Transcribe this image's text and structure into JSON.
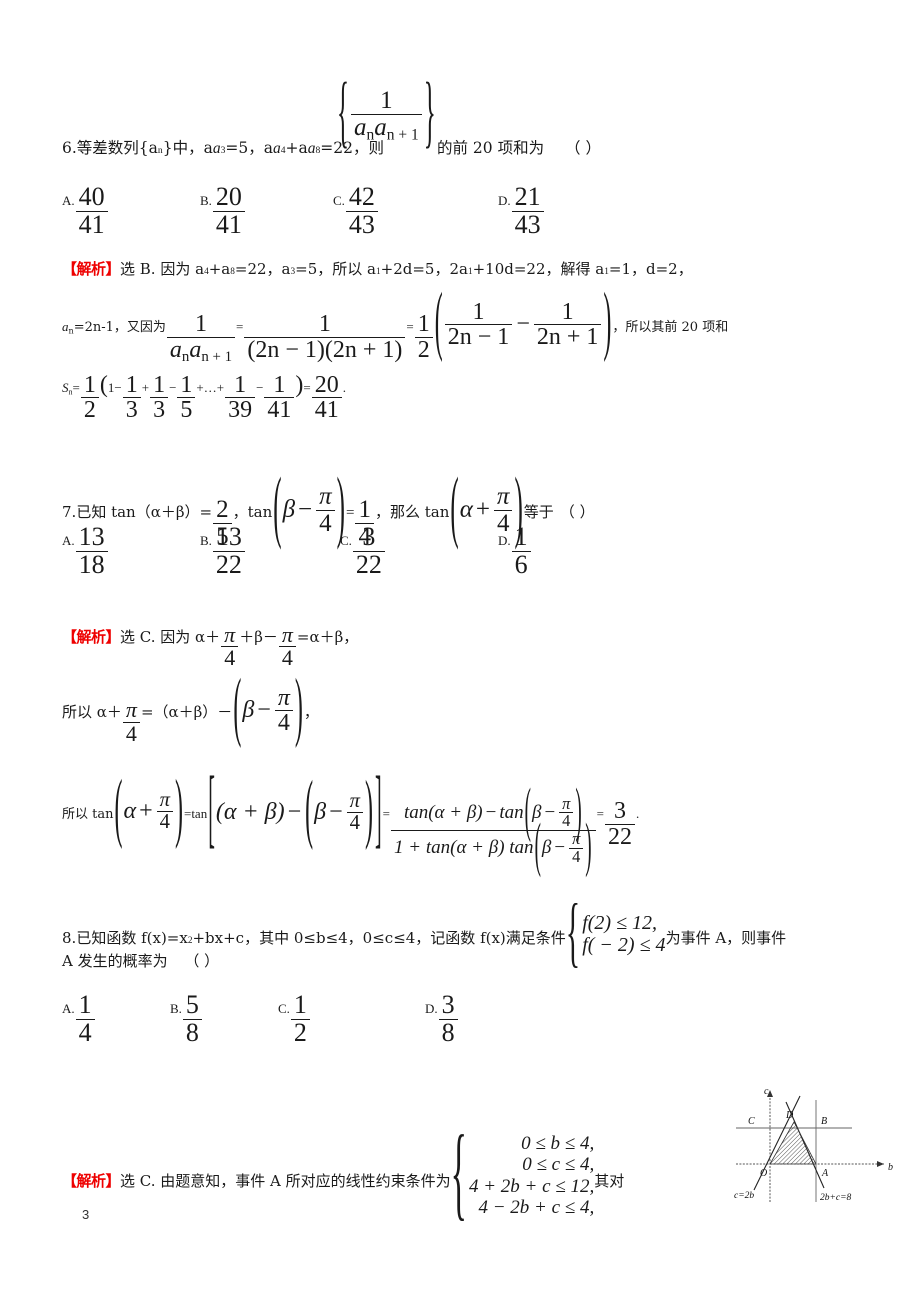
{
  "page": {
    "number": "3",
    "subject_note": ""
  },
  "questions": [
    {
      "id": "q6",
      "number": "6.",
      "stem_before": "等差数列{a",
      "stem_sub1": "n",
      "stem_mid1": "}中，a",
      "stem_sub2": "3",
      "stem_mid2": "=5，a",
      "stem_sub3": "4",
      "stem_mid3": "+a",
      "stem_sub4": "8",
      "stem_mid4": "=22，则",
      "seq_num": "1",
      "seq_den_a": "a",
      "seq_den_sub1": "n",
      "seq_den_b": "a",
      "seq_den_sub2": "n + 1",
      "stem_after": "的前 20 项和为",
      "blank": "（    ）",
      "options": [
        {
          "label": "A.",
          "num": "40",
          "den": "41"
        },
        {
          "label": "B.",
          "num": "20",
          "den": "41"
        },
        {
          "label": "C.",
          "num": "42",
          "den": "43"
        },
        {
          "label": "D.",
          "num": "21",
          "den": "43"
        }
      ],
      "explanation": {
        "tag": "【解析】",
        "line1": "选 B. 因为 a",
        "line1_sub1": "4",
        "line1_b": "+a",
        "line1_sub2": "8",
        "line1_c": "=22，a",
        "line1_sub3": "3",
        "line1_d": "=5，所以 a",
        "line1_sub4": "1",
        "line1_e": "+2d=5，2a",
        "line1_sub5": "1",
        "line1_f": "+10d=22，解得 a",
        "line1_sub6": "1",
        "line1_g": "=1，d=2，",
        "line2_prefix": "a",
        "line2_prefix_sub": "n",
        "line2_prefix_b": "=2n-1，又因为",
        "f1_num": "1",
        "f1_den_a": "a",
        "f1_den_sub1": "n",
        "f1_den_b": "a",
        "f1_den_sub2": "n + 1",
        "eq1": "=",
        "f2_num": "1",
        "f2_den": "(2n − 1)(2n + 1)",
        "eq2": "=",
        "half_num": "1",
        "half_den": "2",
        "inner_left_num": "1",
        "inner_left_den": "2n − 1",
        "inner_minus": "−",
        "inner_right_num": "1",
        "inner_right_den": "2n + 1",
        "line2_suffix": "，所以其前 20 项和",
        "sum_label": "S",
        "sum_label_sub": "n",
        "sum_eq": "=",
        "sum_half_num": "1",
        "sum_half_den": "2",
        "sum_open": "(",
        "sum_t1": "1",
        "sum_f1_num": "1",
        "sum_f1_den": "3",
        "sum_f2_num": "1",
        "sum_f2_den": "3",
        "sum_f3_num": "1",
        "sum_f3_den": "5",
        "sum_dots": "+…+",
        "sum_f4_num": "1",
        "sum_f4_den": "39",
        "sum_f5_num": "1",
        "sum_f5_den": "41",
        "sum_close": ")",
        "sum_res_eq": "=",
        "sum_res_num": "20",
        "sum_res_den": "41",
        "sum_period": "."
      }
    },
    {
      "id": "q7",
      "number": "7.",
      "stem_a": "已知 tan（α＋β）=",
      "v1_num": "2",
      "v1_den": "5",
      "stem_b": "，tan",
      "arg1_beta": "β",
      "arg1_minus": "−",
      "arg1_num": "π",
      "arg1_den": "4",
      "stem_c": "=",
      "v2_num": "1",
      "v2_den": "4",
      "stem_d": "，那么 tan",
      "arg2_alpha": "α",
      "arg2_plus": "+",
      "arg2_num": "π",
      "arg2_den": "4",
      "stem_e": "等于",
      "blank": "（    ）",
      "options": [
        {
          "label": "A.",
          "num": "13",
          "den": "18"
        },
        {
          "label": "B.",
          "num": "13",
          "den": "22"
        },
        {
          "label": "C.",
          "num": "3",
          "den": "22"
        },
        {
          "label": "D.",
          "num": "1",
          "den": "6"
        }
      ],
      "explanation": {
        "tag": "【解析】",
        "l1_a": "选 C. 因为 α＋",
        "l1_f1_num": "π",
        "l1_f1_den": "4",
        "l1_b": "＋β－",
        "l1_f2_num": "π",
        "l1_f2_den": "4",
        "l1_c": "=α＋β，",
        "l2_a": "所以 α＋",
        "l2_f_num": "π",
        "l2_f_den": "4",
        "l2_b": "=（α＋β）－",
        "l2_beta": "β",
        "l2_minus": "−",
        "l2_f2_num": "π",
        "l2_f2_den": "4",
        "l2_c": "，",
        "l3_a": "所以 tan",
        "l3_alpha": "α",
        "l3_plus": "+",
        "l3_f_num": "π",
        "l3_f_den": "4",
        "l3_eq1": "=tan",
        "l3_br_open": "[",
        "l3_g1": "(α + β)",
        "l3_minus": "−",
        "l3_g2_beta": "β",
        "l3_g2_minus": "−",
        "l3_g2_num": "π",
        "l3_g2_den": "4",
        "l3_br_close": "]",
        "l3_eq2": "=",
        "big_num_a": "tan(α + β)",
        "big_num_minus": "−",
        "big_num_b": "tan",
        "big_num_beta": "β",
        "big_num_bminus": "−",
        "big_num_fnum": "π",
        "big_num_fden": "4",
        "big_den_a": "1 + tan(α + β) tan",
        "big_den_beta": "β",
        "big_den_minus": "−",
        "big_den_fnum": "π",
        "big_den_fden": "4",
        "res_eq": "=",
        "res_num": "3",
        "res_den": "22",
        "res_period": "."
      }
    },
    {
      "id": "q8",
      "number": "8.",
      "stem_a": "已知函数 f(x)=x",
      "stem_sup": "2",
      "stem_b": "+bx+c，其中 0≤b≤4，0≤c≤4，记函数 f(x)满足条件",
      "cond_line1": "f(2) ≤ 12,",
      "cond_line2": "f( − 2) ≤ 4",
      "stem_c": "为事件 A，则事件",
      "stem_line2": "A 发生的概率为",
      "blank": "（    ）",
      "options": [
        {
          "label": "A.",
          "num": "1",
          "den": "4"
        },
        {
          "label": "B.",
          "num": "5",
          "den": "8"
        },
        {
          "label": "C.",
          "num": "1",
          "den": "2"
        },
        {
          "label": "D.",
          "num": "3",
          "den": "8"
        }
      ],
      "explanation": {
        "tag": "【解析】",
        "text_a": "选 C. 由题意知，事件 A 所对应的线性约束条件为",
        "sys": [
          "0 ≤ b ≤ 4,",
          "0 ≤ c ≤ 4,",
          "4 + 2b + c ≤ 12,",
          "4 − 2b + c ≤ 4,"
        ],
        "text_b": "其对"
      }
    }
  ],
  "figure": {
    "name": "linear-programming-region",
    "axis_c": "c",
    "axis_b": "b",
    "origin": "O",
    "point_a": "A",
    "point_b": "B",
    "point_c": "C",
    "point_d": "D",
    "line_left": "c=2b",
    "line_right": "2b+c=8"
  },
  "colors": {
    "explanation_tag": "#ee0000",
    "text": "#1a1a1a",
    "paper": "#ffffff"
  }
}
